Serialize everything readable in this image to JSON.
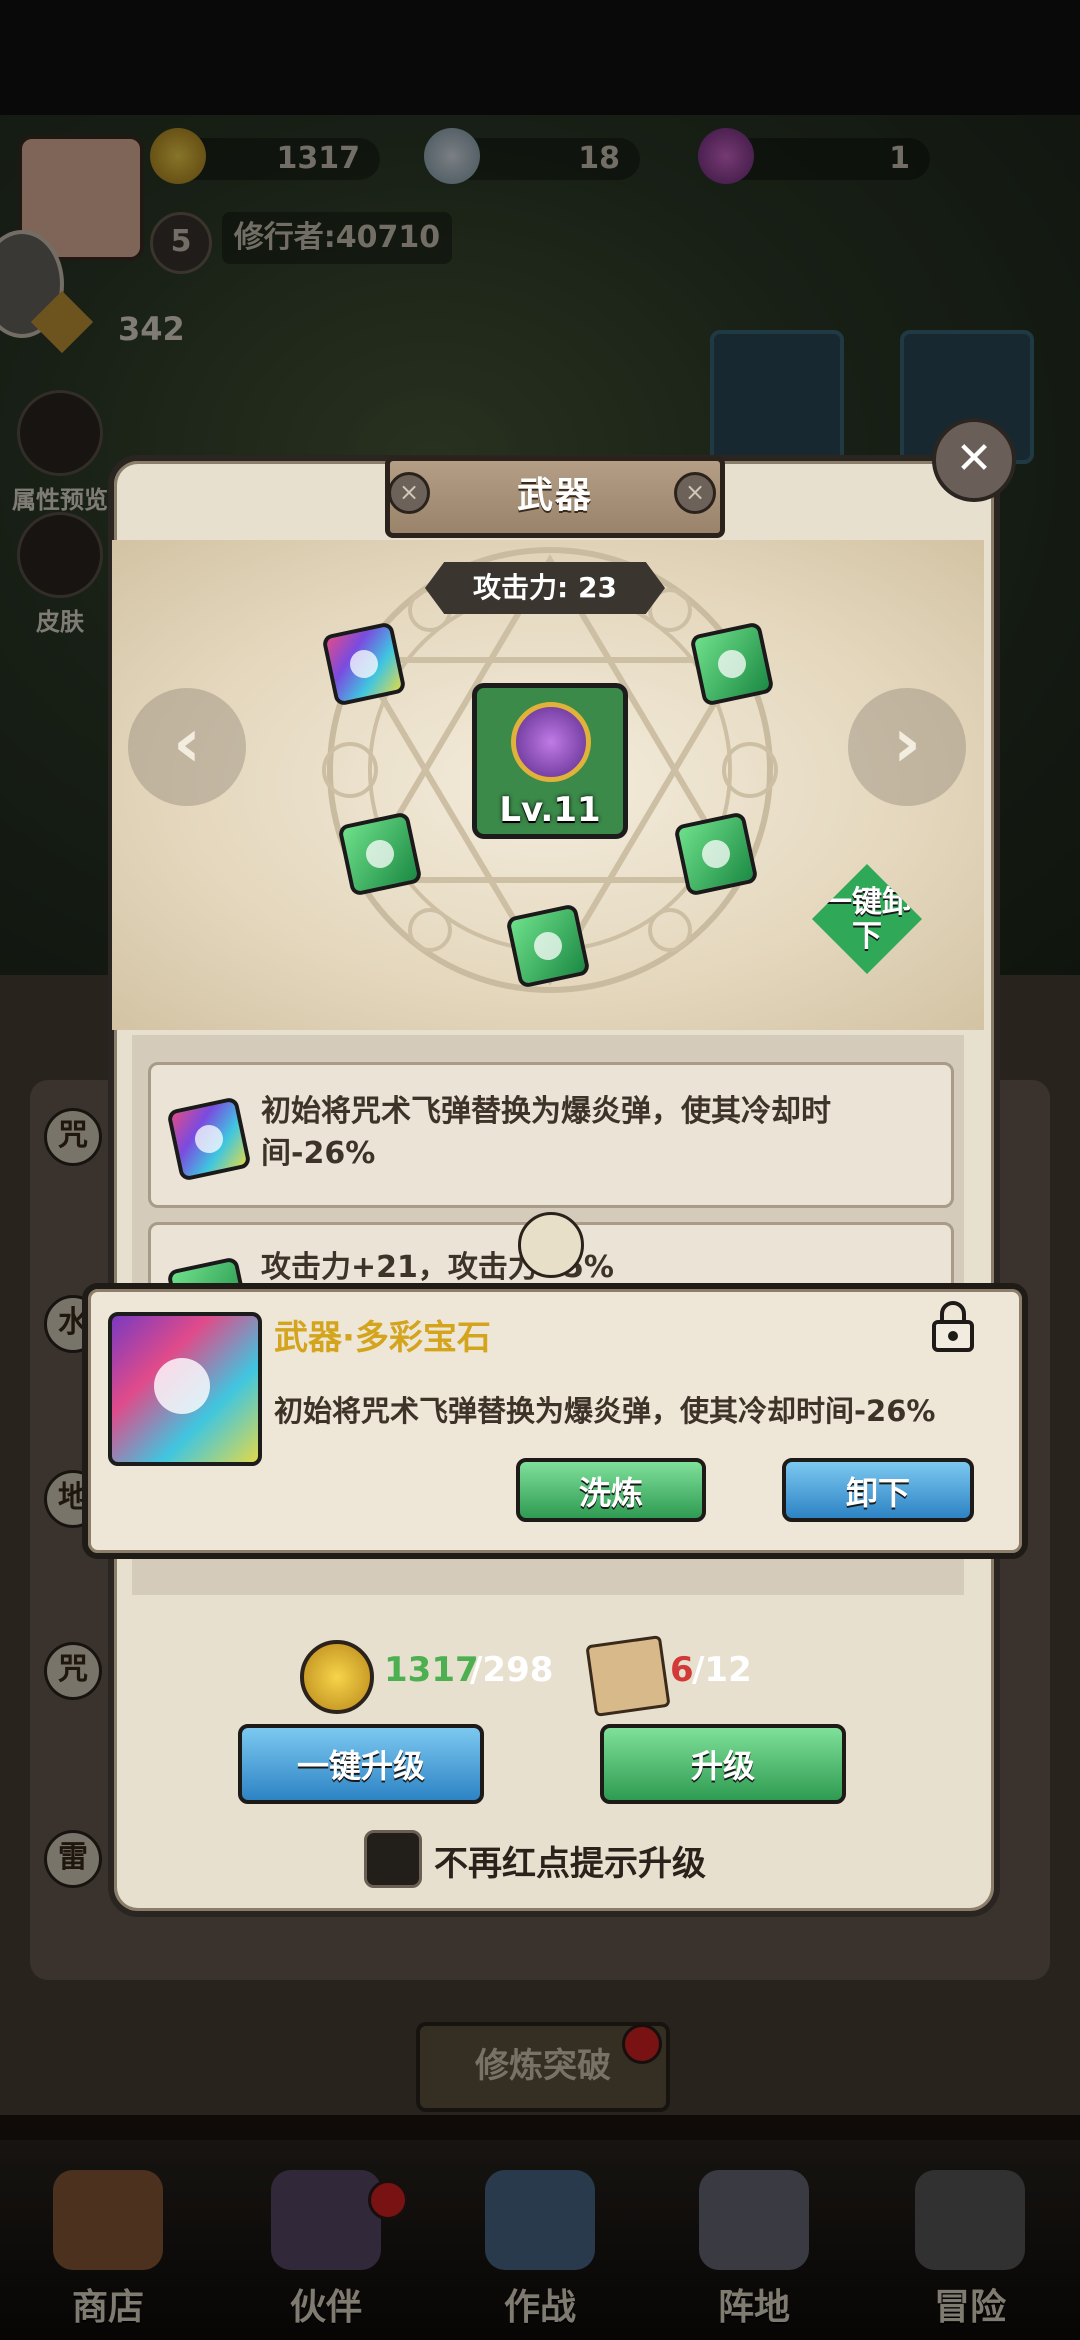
{
  "header": {
    "coins": "1317",
    "crystals": "18",
    "orbs": "1",
    "level": "5",
    "player_name": "修行者:40710",
    "power": "342"
  },
  "side_menu": {
    "attr_preview": "属性预览",
    "skin": "皮肤"
  },
  "dialog": {
    "title": "武器",
    "attack_label": "攻击力: 23",
    "weapon_level": "Lv.11",
    "unequip_all": "一键卸下",
    "effects": [
      {
        "text": "初始将咒术飞弹替换为爆炎弹，使其冷却时间-26%"
      },
      {
        "text": "攻击力+21，攻击力+5%"
      }
    ],
    "cost": {
      "coins_have": "1317",
      "coins_need": "/298",
      "scrolls_have": "6",
      "scrolls_need": "/12"
    },
    "one_click_upgrade": "一键升级",
    "upgrade": "升级",
    "no_red_dot_label": "不再红点提示升级"
  },
  "popup": {
    "name": "武器·多彩宝石",
    "description": "初始将咒术飞弹替换为爆炎弹，使其冷却时间-26%",
    "refine_button": "洗炼",
    "unequip_button": "卸下"
  },
  "behind": {
    "cultivate_button": "修炼突破",
    "side_tags": [
      "咒",
      "水",
      "地",
      "咒",
      "雷"
    ]
  },
  "bottom_nav": [
    {
      "label": "商店",
      "icon": "shop-icon"
    },
    {
      "label": "伙伴",
      "icon": "partner-hat-icon"
    },
    {
      "label": "作战",
      "icon": "battle-book-icon"
    },
    {
      "label": "阵地",
      "icon": "tower-icon"
    },
    {
      "label": "冒险",
      "icon": "adventure-lock-icon"
    }
  ],
  "colors": {
    "green_button": "#2f9b52",
    "blue_button": "#2d83c4",
    "gold_text": "#d3a41c",
    "have_ok": "#4caf50",
    "have_low": "#d23a3a"
  }
}
